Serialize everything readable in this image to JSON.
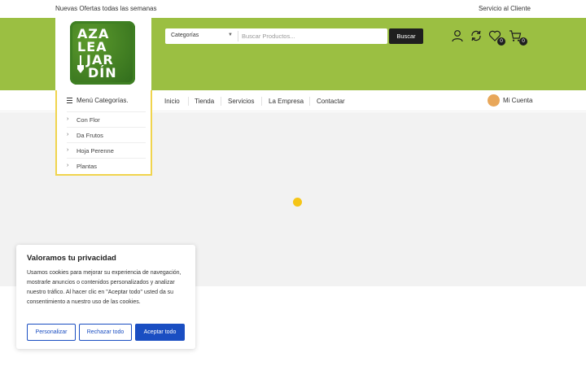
{
  "topbar": {
    "promo": "Nuevas Ofertas todas las semanas",
    "service": "Servicio al Cliente"
  },
  "logo": {
    "line1": "AZA",
    "line2": "LEA",
    "line3": "JAR",
    "line4": "DÍN"
  },
  "search": {
    "category": "Categorías",
    "placeholder": "Buscar Productos...",
    "button": "Buscar"
  },
  "header_icons": {
    "wishlist_count": "0",
    "cart_count": "0"
  },
  "categories": {
    "title": "Menú Categorías.",
    "items": [
      "Con Flor",
      "Da Frutos",
      "Hoja Perenne",
      "Plantas"
    ]
  },
  "nav": {
    "links": [
      "Inicio",
      "Tienda",
      "Servicios",
      "La Empresa",
      "Contactar"
    ],
    "account": "Mi Cuenta"
  },
  "cookie": {
    "title": "Valoramos tu privacidad",
    "text": "Usamos cookies para mejorar su experiencia de navegación, mostrarle anuncios o contenidos personalizados y analizar nuestro tráfico. Al hacer clic en \"Aceptar todo\" usted da su consentimiento a nuestro uso de las cookies.",
    "customize": "Personalizar",
    "reject": "Rechazar todo",
    "accept": "Aceptar todo"
  },
  "colors": {
    "header_green": "#9bbf42",
    "accent_yellow": "#f5c517",
    "cookie_blue": "#1a4ec2"
  }
}
